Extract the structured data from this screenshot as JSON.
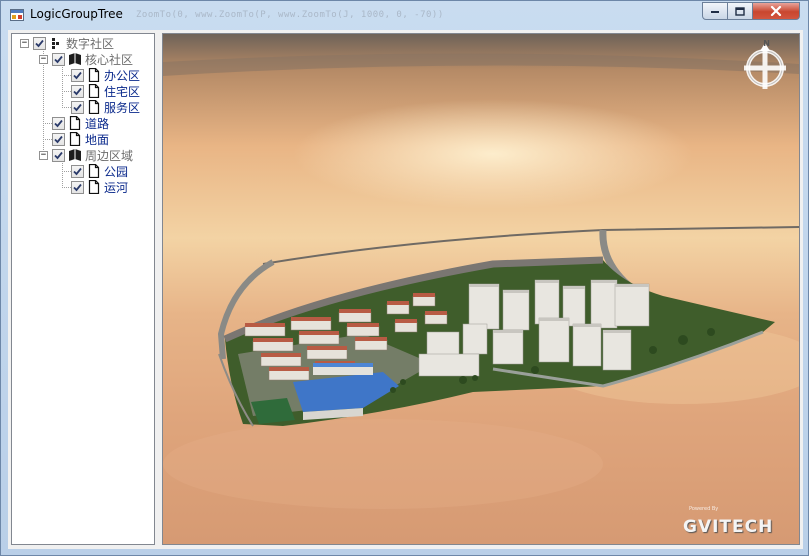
{
  "window": {
    "title": "LogicGroupTree",
    "title_ghost": "ZoomTo(0, www.ZoomTo(P, www.ZoomTo(J, 1000, 0, -70))",
    "controls": {
      "minimize": "minimize",
      "maximize": "maximize",
      "close": "close"
    }
  },
  "tree": {
    "root": {
      "label": "数字社区",
      "checked": true,
      "expanded": true
    },
    "nodes": [
      {
        "label": "核心社区",
        "checked": true,
        "expanded": true,
        "style": "gray"
      },
      {
        "label": "办公区",
        "checked": true,
        "style": "blue"
      },
      {
        "label": "住宅区",
        "checked": true,
        "style": "blue"
      },
      {
        "label": "服务区",
        "checked": true,
        "style": "blue"
      },
      {
        "label": "道路",
        "checked": true,
        "style": "blue"
      },
      {
        "label": "地面",
        "checked": true,
        "style": "blue"
      },
      {
        "label": "周边区域",
        "checked": true,
        "expanded": true,
        "style": "gray"
      },
      {
        "label": "公园",
        "checked": true,
        "style": "blue"
      },
      {
        "label": "运河",
        "checked": true,
        "style": "blue"
      }
    ]
  },
  "viewport": {
    "compass_north": "N",
    "powered_by": "Powered By",
    "brand": "GVITECH"
  },
  "colors": {
    "sky_top": "#7a6a5c",
    "sky_mid": "#e8b98a",
    "sky_low": "#d9a47c",
    "grass": "#3d5a2a",
    "road": "#8a8a86",
    "building_white": "#e6e4de",
    "roof_red": "#b45a45",
    "roof_blue": "#3a6fc4",
    "tree_text_blue": "#0b2a8c",
    "tree_text_gray": "#6d6d6d"
  }
}
